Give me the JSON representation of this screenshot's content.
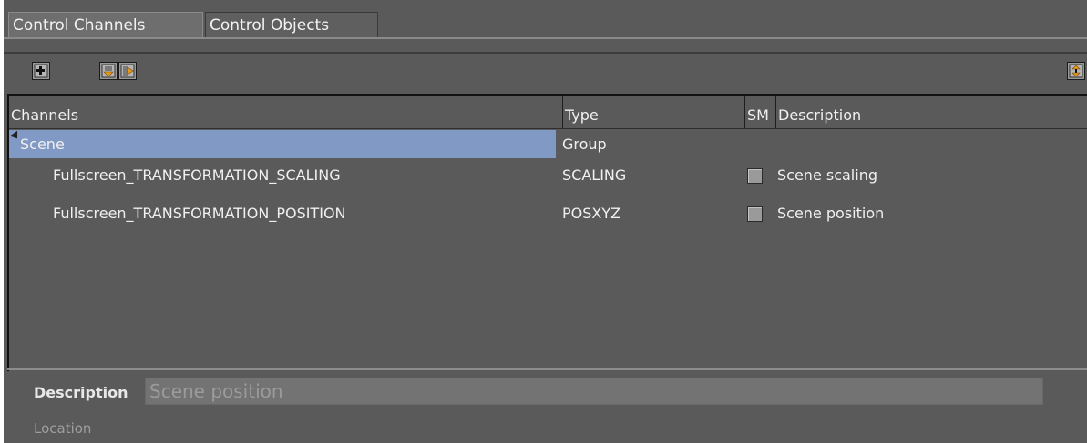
{
  "tabs": [
    {
      "label": "Control Channels",
      "active": true
    },
    {
      "label": "Control Objects",
      "active": false
    }
  ],
  "toolbar": {
    "icons": [
      "add-channel-icon",
      "import-icon",
      "export-icon",
      "expand-collapse-icon"
    ]
  },
  "table": {
    "columns": [
      "Channels",
      "Type",
      "SM",
      "Description"
    ],
    "rows": [
      {
        "channel": "Scene",
        "type": "Group",
        "sm": "",
        "description": "",
        "is_group": true,
        "selected": true
      },
      {
        "channel": "Fullscreen_TRANSFORMATION_SCALING",
        "type": "SCALING",
        "sm": "unchecked",
        "description": "Scene scaling"
      },
      {
        "channel": "Fullscreen_TRANSFORMATION_POSITION",
        "type": "POSXYZ",
        "sm": "unchecked",
        "description": "Scene position"
      }
    ]
  },
  "details": {
    "description_label": "Description",
    "description_value": "Scene position",
    "location_label": "Location"
  },
  "colors": {
    "panel_bg": "#5a5a5a",
    "selection": "#8199c5",
    "text": "#f0f0f0"
  }
}
